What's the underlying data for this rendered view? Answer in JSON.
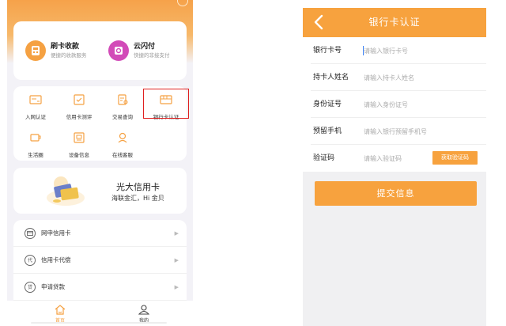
{
  "left": {
    "payments": [
      {
        "title": "刷卡收款",
        "subtitle": "便捷的收款服务",
        "icon": "card-reader-icon",
        "color": "#f5a142"
      },
      {
        "title": "云闪付",
        "subtitle": "快捷的非接支付",
        "icon": "cloud-pay-icon",
        "color": "#d24bb8"
      }
    ],
    "grid": [
      {
        "label": "入网认证",
        "icon": "id-card-icon"
      },
      {
        "label": "信用卡测评",
        "icon": "check-card-icon"
      },
      {
        "label": "交易查询",
        "icon": "document-search-icon"
      },
      {
        "label": "银行卡认证",
        "icon": "bank-card-icon"
      },
      {
        "label": "生活圈",
        "icon": "coffee-cup-icon"
      },
      {
        "label": "设备信息",
        "icon": "device-icon"
      },
      {
        "label": "在线客服",
        "icon": "customer-service-icon"
      }
    ],
    "promo": {
      "title": "光大信用卡",
      "subtitle": "海联金汇，Hi 金贝"
    },
    "list": [
      {
        "label": "网申信用卡",
        "icon": "credit-card-icon"
      },
      {
        "label": "信用卡代偿",
        "icon": "dai-badge-icon",
        "badge": "代"
      },
      {
        "label": "申请贷款",
        "icon": "loan-icon",
        "badge": "贷"
      }
    ],
    "tabs": [
      {
        "label": "首页",
        "icon": "home-icon",
        "active": true
      },
      {
        "label": "我的",
        "icon": "user-icon",
        "active": false
      }
    ],
    "highlight_color": "#e02020",
    "accent": "#f5a142"
  },
  "right": {
    "title": "银行卡认证",
    "fields": [
      {
        "label": "银行卡号",
        "placeholder": "请输入银行卡号"
      },
      {
        "label": "持卡人姓名",
        "placeholder": "请输入持卡人姓名"
      },
      {
        "label": "身份证号",
        "placeholder": "请输入身份证号"
      },
      {
        "label": "预留手机",
        "placeholder": "请输入银行预留手机号"
      },
      {
        "label": "验证码",
        "placeholder": "请输入验证码"
      }
    ],
    "get_code": "获取验证码",
    "submit": "提交信息",
    "accent": "#f7a23e"
  }
}
